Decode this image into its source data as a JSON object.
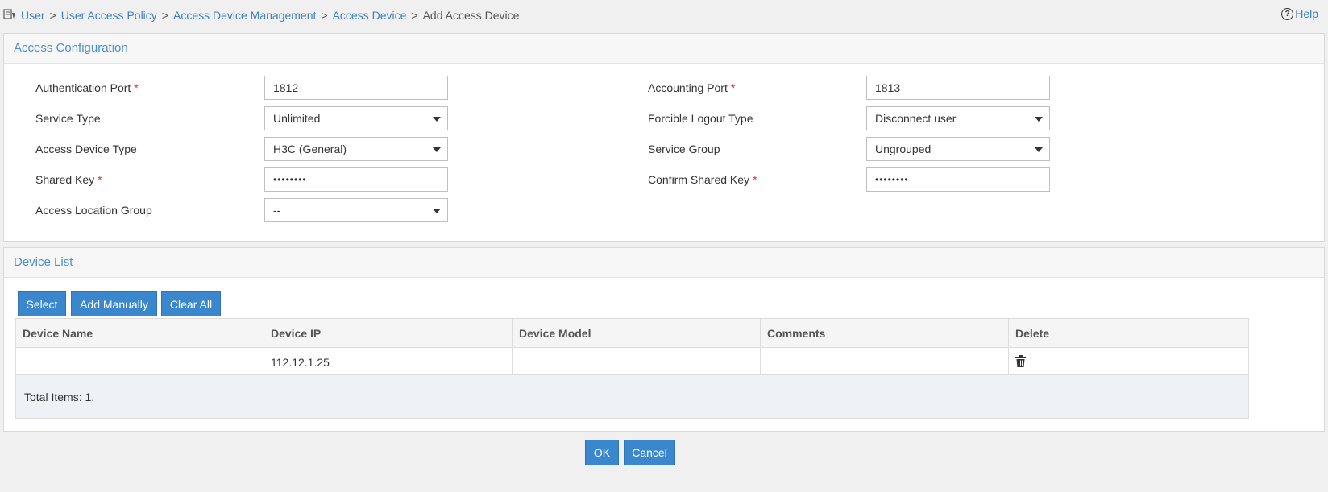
{
  "breadcrumb": {
    "items": [
      "User",
      "User Access Policy",
      "Access Device Management",
      "Access Device"
    ],
    "separator": ">",
    "current": "Add Access Device"
  },
  "help": {
    "label": "Help"
  },
  "config": {
    "title": "Access Configuration",
    "required_mark": "*",
    "auth_port": {
      "label": "Authentication Port",
      "value": "1812"
    },
    "acct_port": {
      "label": "Accounting Port",
      "value": "1813"
    },
    "service_type": {
      "label": "Service Type",
      "value": "Unlimited"
    },
    "logout_type": {
      "label": "Forcible Logout Type",
      "value": "Disconnect user"
    },
    "device_type": {
      "label": "Access Device Type",
      "value": "H3C (General)"
    },
    "service_group": {
      "label": "Service Group",
      "value": "Ungrouped"
    },
    "shared_key": {
      "label": "Shared Key",
      "value": "••••••••"
    },
    "confirm_key": {
      "label": "Confirm Shared Key",
      "value": "••••••••"
    },
    "location_group": {
      "label": "Access Location Group",
      "value": "--"
    }
  },
  "device_list": {
    "title": "Device List",
    "buttons": {
      "select": "Select",
      "add_manually": "Add Manually",
      "clear_all": "Clear All"
    },
    "columns": [
      "Device Name",
      "Device IP",
      "Device Model",
      "Comments",
      "Delete"
    ],
    "rows": [
      {
        "name": "",
        "ip": "112.12.1.25",
        "model": "",
        "comments": "",
        "delete_icon": "trash-icon"
      }
    ],
    "total": "Total Items: 1."
  },
  "actions": {
    "ok": "OK",
    "cancel": "Cancel"
  },
  "colors": {
    "accent": "#3a87cd",
    "link": "#3b7fc4",
    "required": "#e0312b"
  }
}
